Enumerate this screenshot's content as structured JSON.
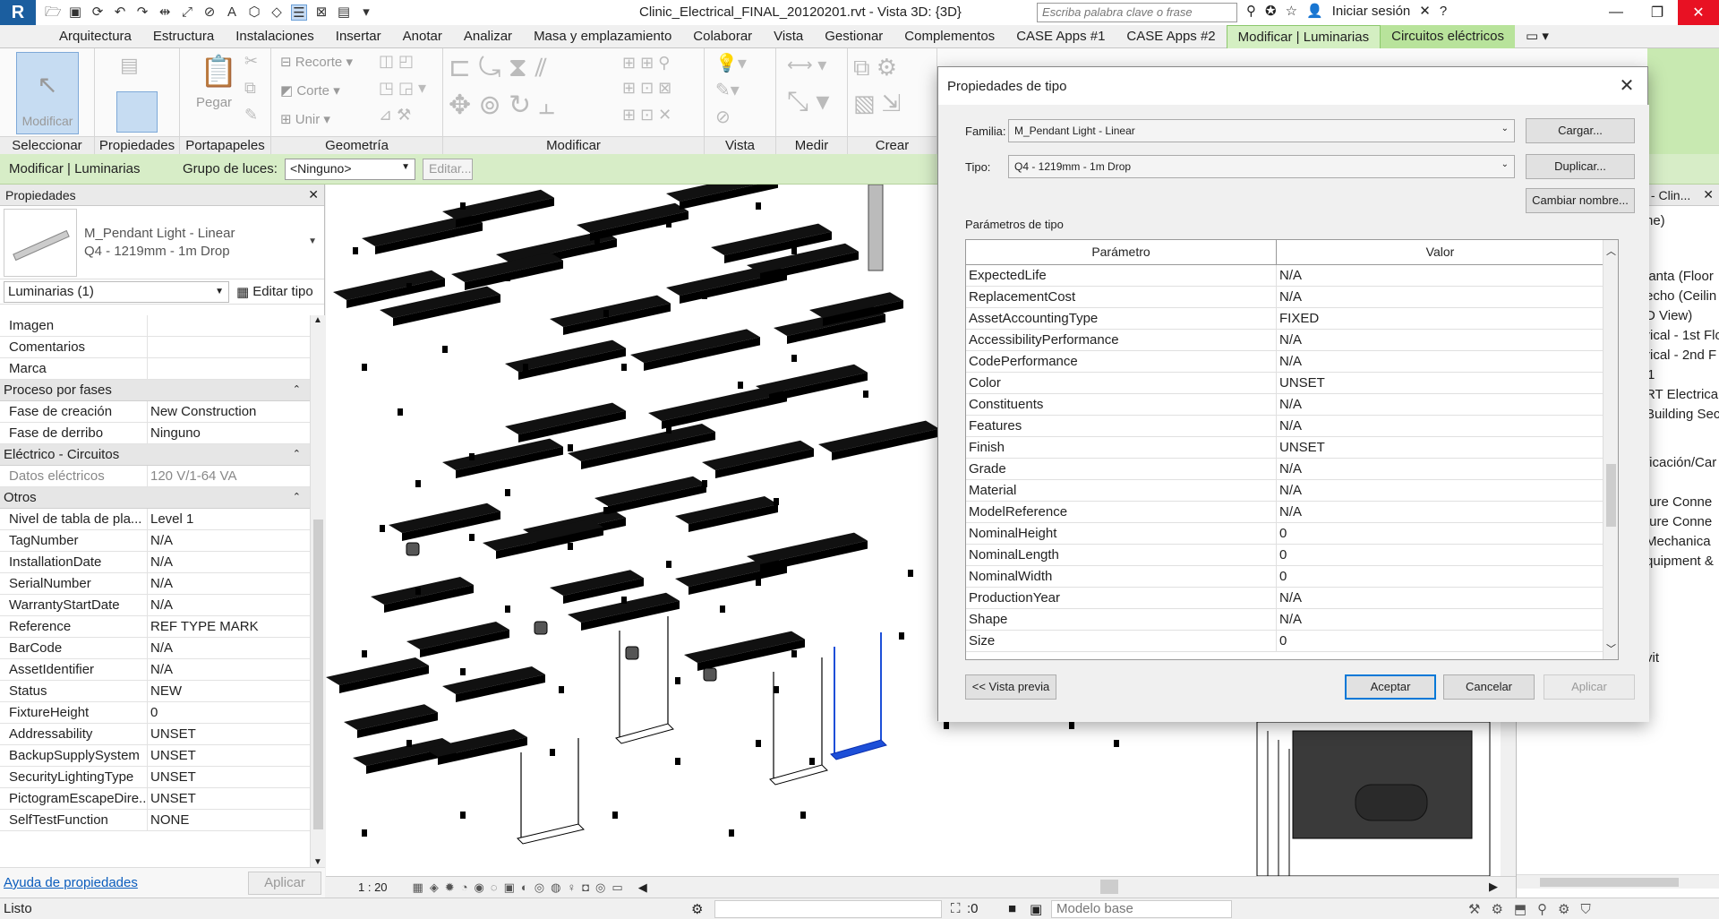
{
  "app": {
    "logo": "R",
    "doc_title": "Clinic_Electrical_FINAL_20120201.rvt - Vista 3D: {3D}",
    "search_placeholder": "Escriba palabra clave o frase",
    "signin": "Iniciar sesión"
  },
  "tabs": [
    "Arquitectura",
    "Estructura",
    "Instalaciones",
    "Insertar",
    "Anotar",
    "Analizar",
    "Masa y emplazamiento",
    "Colaborar",
    "Vista",
    "Gestionar",
    "Complementos",
    "CASE Apps #1",
    "CASE Apps #2",
    "Modificar | Luminarias",
    "Circuitos eléctricos"
  ],
  "ribbon": {
    "modify_btn": "Modificar",
    "paste": "Pegar",
    "cut": "Recorte",
    "cope": "Corte",
    "join": "Unir",
    "panels": [
      "Seleccionar",
      "Propiedades",
      "Portapapeles",
      "Geometría",
      "Modificar",
      "Vista",
      "Medir",
      "Crear"
    ]
  },
  "optbar": {
    "context": "Modificar | Luminarias",
    "group_label": "Grupo de luces:",
    "group_value": "<Ninguno>",
    "edit": "Editar..."
  },
  "properties": {
    "title": "Propiedades",
    "family": "M_Pendant Light - Linear",
    "type": "Q4 - 1219mm - 1m Drop",
    "instance": "Luminarias (1)",
    "edit_type": "Editar tipo",
    "help": "Ayuda de propiedades",
    "apply": "Aplicar",
    "rows_top": [
      {
        "name": "Imagen",
        "value": ""
      },
      {
        "name": "Comentarios",
        "value": ""
      },
      {
        "name": "Marca",
        "value": ""
      }
    ],
    "group_phase": "Proceso por fases",
    "rows_phase": [
      {
        "name": "Fase de creación",
        "value": "New Construction"
      },
      {
        "name": "Fase de derribo",
        "value": "Ninguno"
      }
    ],
    "group_elec": "Eléctrico - Circuitos",
    "rows_elec": [
      {
        "name": "Datos eléctricos",
        "value": "120 V/1-64 VA"
      }
    ],
    "group_other": "Otros",
    "rows_other": [
      {
        "name": "Nivel de tabla de pla...",
        "value": "Level 1"
      },
      {
        "name": "TagNumber",
        "value": "N/A"
      },
      {
        "name": "InstallationDate",
        "value": "N/A"
      },
      {
        "name": "SerialNumber",
        "value": "N/A"
      },
      {
        "name": "WarrantyStartDate",
        "value": "N/A"
      },
      {
        "name": "Reference",
        "value": "REF TYPE MARK"
      },
      {
        "name": "BarCode",
        "value": "N/A"
      },
      {
        "name": "AssetIdentifier",
        "value": "N/A"
      },
      {
        "name": "Status",
        "value": "NEW"
      },
      {
        "name": "FixtureHeight",
        "value": "0"
      },
      {
        "name": "Addressability",
        "value": "UNSET"
      },
      {
        "name": "BackupSupplySystem",
        "value": "UNSET"
      },
      {
        "name": "SecurityLightingType",
        "value": "UNSET"
      },
      {
        "name": "PictogramEscapeDire...",
        "value": "UNSET"
      },
      {
        "name": "SelfTestFunction",
        "value": "NONE"
      }
    ]
  },
  "viewbar": {
    "scale": "1 : 20"
  },
  "browser": {
    "head": "es - Clin...",
    "items": [
      "ne)",
      "lanta (Floor",
      "echo (Ceilin",
      "D View)",
      "rical - 1st Flo",
      "rical - 2nd F",
      "1",
      "RT Electrica",
      "Building Sec",
      "ficación/Car",
      "ture Conne",
      "ture Conne",
      "Mechanica",
      "quipment &",
      "vit"
    ]
  },
  "status": {
    "left": "Listo",
    "zero": ":0",
    "model": "Modelo base"
  },
  "dialog": {
    "title": "Propiedades de tipo",
    "family_label": "Familia:",
    "family_value": "M_Pendant Light - Linear",
    "type_label": "Tipo:",
    "type_value": "Q4 - 1219mm - 1m Drop",
    "load": "Cargar...",
    "duplicate": "Duplicar...",
    "rename": "Cambiar nombre...",
    "params_label": "Parámetros de tipo",
    "col_param": "Parámetro",
    "col_value": "Valor",
    "rows": [
      {
        "name": "ExpectedLife",
        "value": "N/A"
      },
      {
        "name": "ReplacementCost",
        "value": "N/A"
      },
      {
        "name": "AssetAccountingType",
        "value": "FIXED"
      },
      {
        "name": "AccessibilityPerformance",
        "value": "N/A"
      },
      {
        "name": "CodePerformance",
        "value": "N/A"
      },
      {
        "name": "Color",
        "value": "UNSET"
      },
      {
        "name": "Constituents",
        "value": "N/A"
      },
      {
        "name": "Features",
        "value": "N/A"
      },
      {
        "name": "Finish",
        "value": "UNSET"
      },
      {
        "name": "Grade",
        "value": "N/A"
      },
      {
        "name": "Material",
        "value": "N/A"
      },
      {
        "name": "ModelReference",
        "value": "N/A"
      },
      {
        "name": "NominalHeight",
        "value": "0"
      },
      {
        "name": "NominalLength",
        "value": "0"
      },
      {
        "name": "NominalWidth",
        "value": "0"
      },
      {
        "name": "ProductionYear",
        "value": "N/A"
      },
      {
        "name": "Shape",
        "value": "N/A"
      },
      {
        "name": "Size",
        "value": "0"
      }
    ],
    "preview": "<< Vista previa",
    "ok": "Aceptar",
    "cancel": "Cancelar",
    "apply": "Aplicar"
  },
  "colors": {
    "accent": "#0078d7",
    "context_tab": "#b8e39b",
    "selection": "#1d4fd8"
  }
}
